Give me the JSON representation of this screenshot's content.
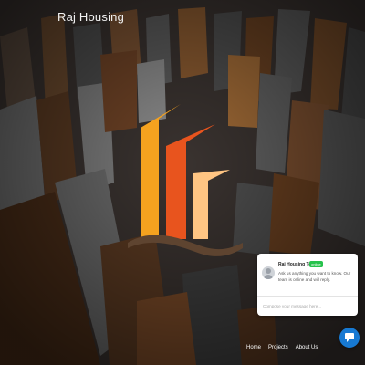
{
  "site": {
    "title": "Raj Housing"
  },
  "nav": {
    "items": [
      "Home",
      "Projects",
      "About Us"
    ]
  },
  "chat": {
    "team_name": "Raj Housing Team",
    "status": "online",
    "message": "Ask us anything you want to know. Our team is online and will reply.",
    "compose_placeholder": "Compose your message here..."
  },
  "colors": {
    "logo_orange": "#f5a21f",
    "logo_red": "#e8541e",
    "logo_peach": "#ffc583",
    "logo_wave": "#5e4430",
    "online_green": "#27c24c",
    "chat_button_blue": "#1779d2"
  },
  "icons": {
    "chat_launcher": "chat-bubble-icon",
    "avatar": "user-avatar-icon"
  }
}
